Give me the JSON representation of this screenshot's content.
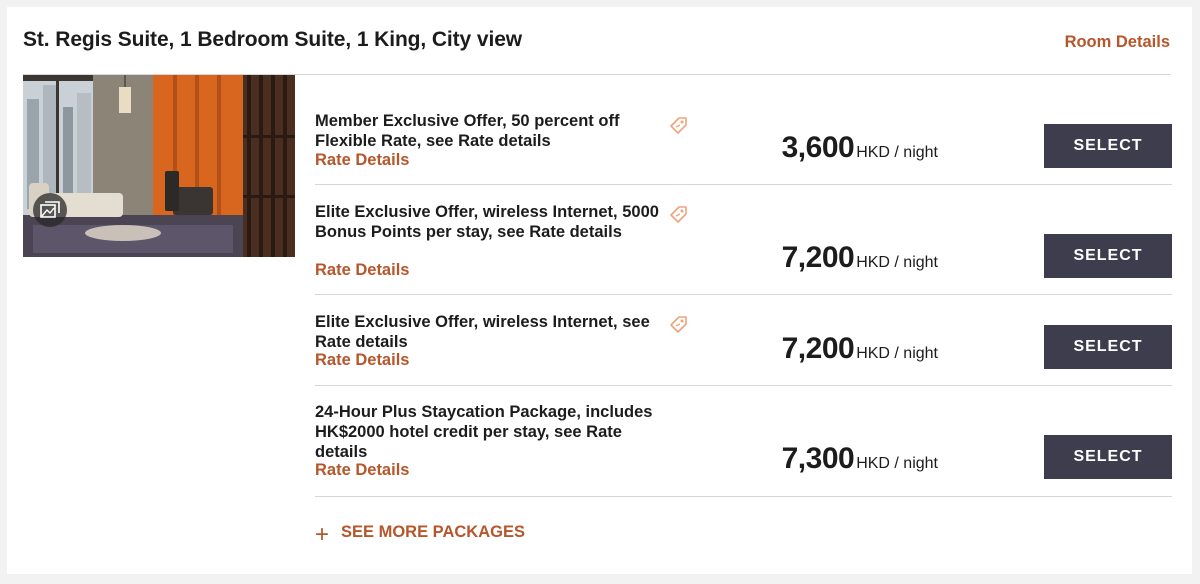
{
  "room": {
    "title": "St. Regis Suite, 1 Bedroom Suite, 1 King, City view",
    "details_link": "Room Details"
  },
  "photo": {
    "icon": "gallery-icon"
  },
  "rates": [
    {
      "description": "Member Exclusive Offer, 50 percent off Flexible Rate, see Rate details",
      "link": "Rate Details",
      "price": "3,600",
      "unit": "HKD / night",
      "button": "SELECT",
      "tag_icon": "offer-tag-icon"
    },
    {
      "description": "Elite Exclusive Offer, wireless Internet, 5000 Bonus Points per stay, see Rate details",
      "link": "Rate Details",
      "price": "7,200",
      "unit": "HKD / night",
      "button": "SELECT",
      "tag_icon": "offer-tag-icon"
    },
    {
      "description": "Elite Exclusive Offer, wireless Internet, see Rate details",
      "link": "Rate Details",
      "price": "7,200",
      "unit": "HKD / night",
      "button": "SELECT",
      "tag_icon": "offer-tag-icon"
    },
    {
      "description": "24-Hour Plus Staycation Package, includes HK$2000 hotel credit per stay, see Rate details",
      "link": "Rate Details",
      "price": "7,300",
      "unit": "HKD / night",
      "button": "SELECT",
      "tag_icon": null
    }
  ],
  "more_packages": "SEE MORE PACKAGES",
  "colors": {
    "accent": "#b5562b",
    "button": "#3d3d4d",
    "divider": "#d6d6d6"
  }
}
